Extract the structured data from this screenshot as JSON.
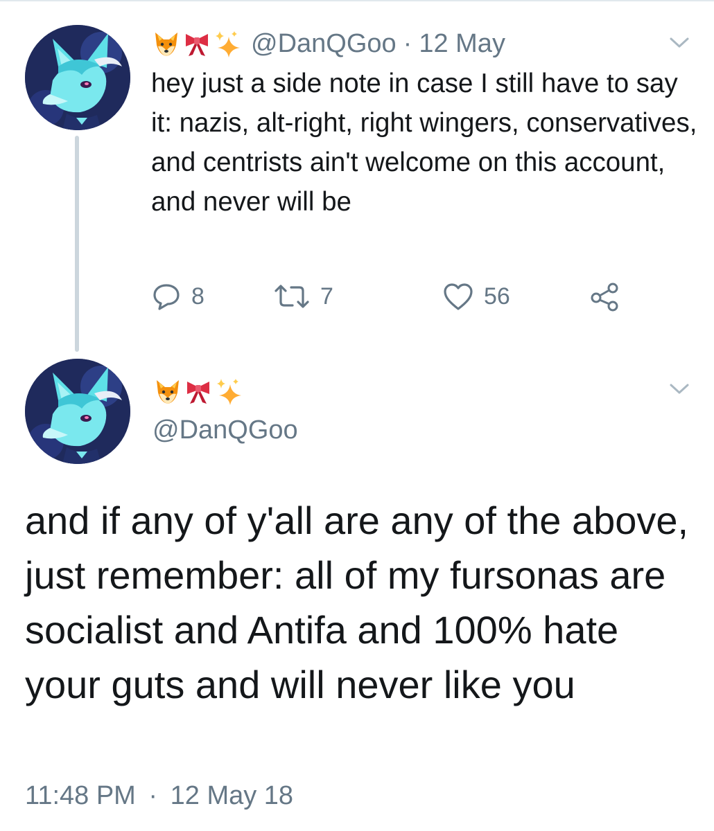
{
  "tweet1": {
    "handle": "@DanQGoo",
    "separator": "·",
    "date": "12 May",
    "text": "hey just a side note in case I still have to say it: nazis, alt-right, right wingers, conservatives, and centrists ain't welcome on this account, and never will be",
    "emojis": [
      "fox-face-icon",
      "ribbon-icon",
      "sparkles-icon"
    ],
    "stats": {
      "replies": "8",
      "retweets": "7",
      "likes": "56"
    }
  },
  "tweet2": {
    "handle": "@DanQGoo",
    "emojis": [
      "fox-face-icon",
      "ribbon-icon",
      "sparkles-icon"
    ],
    "text": "and if any of y'all are any of the above, just remember: all of my fursonas are socialist and Antifa and 100% hate your guts and will never like you",
    "time": "11:48 PM",
    "separator": "·",
    "date": "12 May 18"
  },
  "colors": {
    "text_primary": "#14171a",
    "text_secondary": "#657786",
    "thread_line": "#ccd6dd",
    "avatar_bg": "#1f2a5c",
    "avatar_accent": "#5ee0e8"
  }
}
